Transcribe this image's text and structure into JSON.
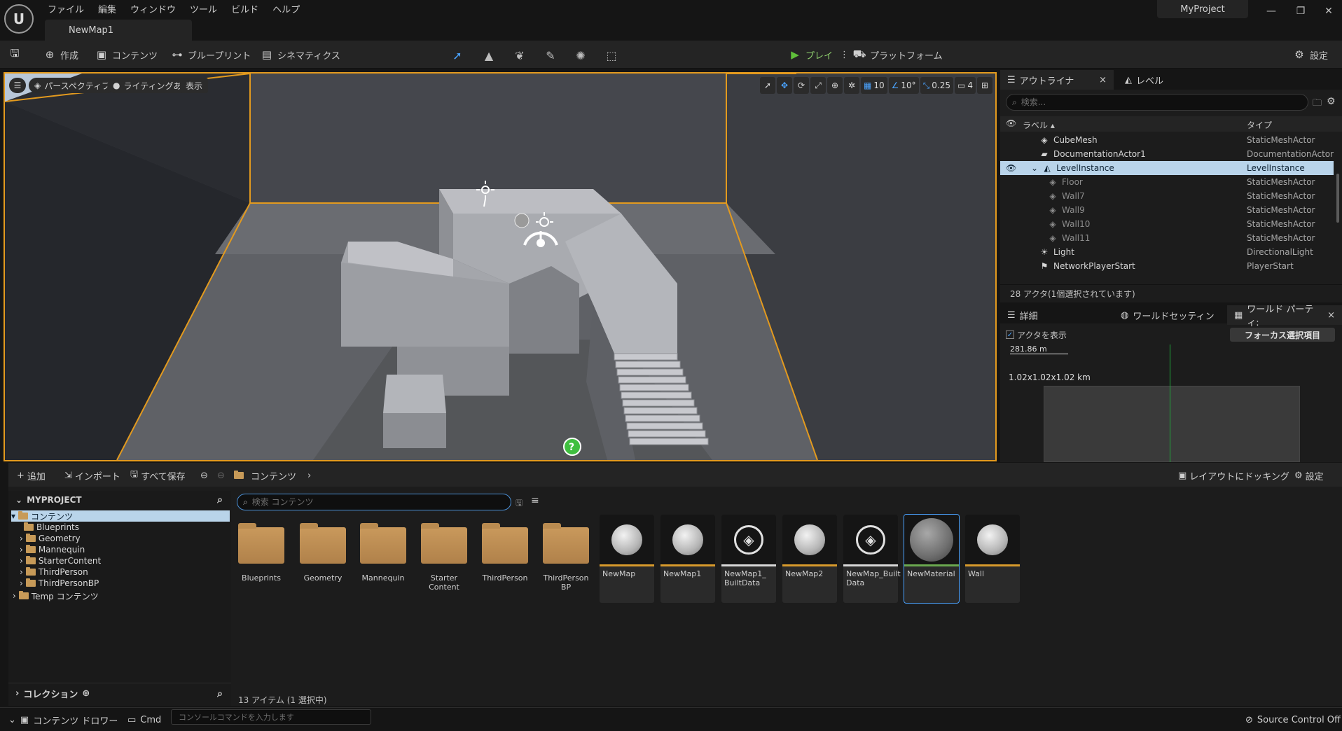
{
  "menu": [
    "ファイル",
    "編集",
    "ウィンドウ",
    "ツール",
    "ビルド",
    "ヘルプ"
  ],
  "map_tab": "NewMap1",
  "project_name": "MyProject",
  "toolbar": {
    "create": "作成",
    "content": "コンテンツ",
    "blueprint": "ブループリント",
    "cinematics": "シネマティクス",
    "play": "プレイ",
    "platform": "プラットフォーム",
    "settings": "設定"
  },
  "viewport": {
    "perspective": "パースペクティブ",
    "lighting": "ライティングあり",
    "show": "表示",
    "grid_snap": "10",
    "rotation_snap": "10°",
    "scale_snap": "0.25",
    "camera_speed": "4"
  },
  "outliner": {
    "tab_outliner": "アウトライナ",
    "tab_levels": "レベル",
    "search_placeholder": "検索...",
    "col_label": "ラベル",
    "col_type": "タイプ",
    "rows": [
      {
        "label": "CubeMesh",
        "type": "StaticMeshActor",
        "icon": "cube-icon"
      },
      {
        "label": "DocumentationActor1",
        "type": "DocumentationActor",
        "icon": "book-icon"
      },
      {
        "label": "LevelInstance",
        "type": "LevelInstance",
        "icon": "level-instance-icon",
        "selected": true
      },
      {
        "label": "Floor",
        "type": "StaticMeshActor",
        "icon": "cube-icon",
        "child": true
      },
      {
        "label": "Wall7",
        "type": "StaticMeshActor",
        "icon": "cube-icon",
        "child": true
      },
      {
        "label": "Wall9",
        "type": "StaticMeshActor",
        "icon": "cube-icon",
        "child": true
      },
      {
        "label": "Wall10",
        "type": "StaticMeshActor",
        "icon": "cube-icon",
        "child": true
      },
      {
        "label": "Wall11",
        "type": "StaticMeshActor",
        "icon": "cube-icon",
        "child": true
      },
      {
        "label": "Light",
        "type": "DirectionalLight",
        "icon": "sun-icon"
      },
      {
        "label": "NetworkPlayerStart",
        "type": "PlayerStart",
        "icon": "player-start-icon"
      }
    ],
    "status": "28 アクタ(1個選択されています)"
  },
  "details": {
    "tab_details": "詳細",
    "tab_world_settings": "ワールドセッティン",
    "tab_world_partition": "ワールド パーティ:",
    "show_actors": "アクタを表示",
    "focus_selection": "フォーカス選択項目",
    "scale_distance": "281.86 m",
    "world_bounds": "1.02x1.02x1.02 km"
  },
  "content_browser": {
    "add": "追加",
    "import": "インポート",
    "save_all": "すべて保存",
    "path": "コンテンツ",
    "dock_layout": "レイアウトにドッキング",
    "settings": "設定",
    "tree_root": "MYPROJECT",
    "tree": [
      {
        "label": "コンテンツ",
        "level": 0,
        "expanded": true,
        "selected": true
      },
      {
        "label": "Blueprints",
        "level": 1
      },
      {
        "label": "Geometry",
        "level": 1,
        "has_children": true
      },
      {
        "label": "Mannequin",
        "level": 1,
        "has_children": true
      },
      {
        "label": "StarterContent",
        "level": 1,
        "has_children": true
      },
      {
        "label": "ThirdPerson",
        "level": 1,
        "has_children": true
      },
      {
        "label": "ThirdPersonBP",
        "level": 1,
        "has_children": true
      },
      {
        "label": "Temp コンテンツ",
        "level": 0,
        "has_children": true
      }
    ],
    "collections": "コレクション",
    "search_placeholder": "検索 コンテンツ",
    "folders": [
      "Blueprints",
      "Geometry",
      "Mannequin",
      "Starter\nContent",
      "ThirdPerson",
      "ThirdPerson\nBP"
    ],
    "assets": [
      {
        "name": "NewMap",
        "kind": "map"
      },
      {
        "name": "NewMap1",
        "kind": "map"
      },
      {
        "name": "NewMap1_\nBuiltData",
        "kind": "builtdata"
      },
      {
        "name": "NewMap2",
        "kind": "map"
      },
      {
        "name": "NewMap_Built\nData",
        "kind": "builtdata"
      },
      {
        "name": "NewMaterial",
        "kind": "material",
        "selected": true
      },
      {
        "name": "Wall",
        "kind": "map"
      }
    ],
    "status": "13 アイテム (1 選択中)"
  },
  "statusbar": {
    "content_drawer": "コンテンツ ドロワー",
    "cmd": "Cmd",
    "console_placeholder": "コンソールコマンドを入力します",
    "source_control": "Source Control Off"
  },
  "colors": {
    "accent_orange": "#e39a1e",
    "selection_blue": "#b9d4ea",
    "play_green": "#5fbf3a",
    "focus_blue": "#4aa3ff"
  }
}
